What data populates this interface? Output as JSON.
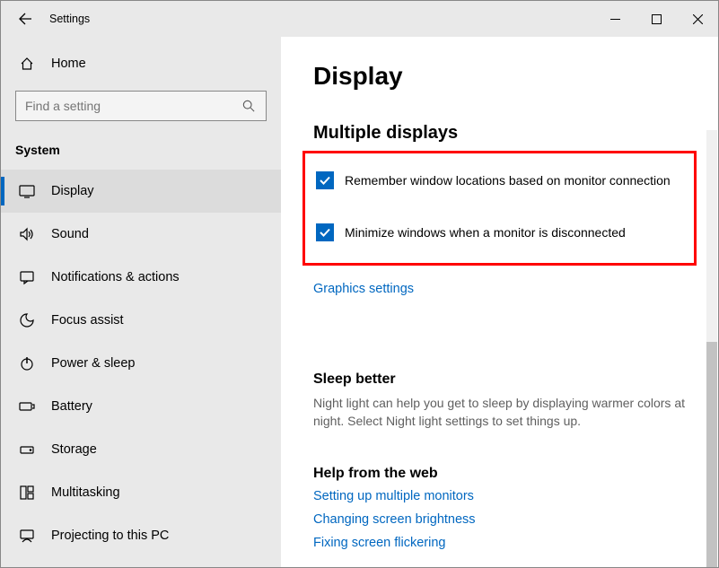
{
  "window": {
    "title": "Settings"
  },
  "sidebar": {
    "home_label": "Home",
    "search_placeholder": "Find a setting",
    "category": "System",
    "items": [
      {
        "label": "Display"
      },
      {
        "label": "Sound"
      },
      {
        "label": "Notifications & actions"
      },
      {
        "label": "Focus assist"
      },
      {
        "label": "Power & sleep"
      },
      {
        "label": "Battery"
      },
      {
        "label": "Storage"
      },
      {
        "label": "Multitasking"
      },
      {
        "label": "Projecting to this PC"
      }
    ]
  },
  "main": {
    "title": "Display",
    "multiple_displays": {
      "heading": "Multiple displays",
      "remember_label": "Remember window locations based on monitor connection",
      "minimize_label": "Minimize windows when a monitor is disconnected",
      "graphics_link": "Graphics settings"
    },
    "sleep": {
      "heading": "Sleep better",
      "desc": "Night light can help you get to sleep by displaying warmer colors at night. Select Night light settings to set things up."
    },
    "help": {
      "heading": "Help from the web",
      "links": [
        "Setting up multiple monitors",
        "Changing screen brightness",
        "Fixing screen flickering"
      ]
    }
  }
}
